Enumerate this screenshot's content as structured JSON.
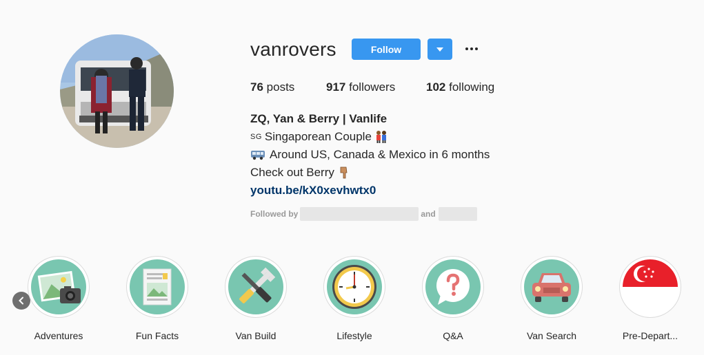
{
  "profile": {
    "username": "vanrovers",
    "follow_label": "Follow",
    "stats": {
      "posts_count": "76",
      "posts_label": "posts",
      "followers_count": "917",
      "followers_label": "followers",
      "following_count": "102",
      "following_label": "following"
    },
    "bio": {
      "name": "ZQ, Yan & Berry | Vanlife",
      "line1_flag": "SG",
      "line1": "Singaporean Couple",
      "line2": "Around US, Canada & Mexico in 6 months",
      "line3": "Check out Berry",
      "link": "youtu.be/kX0xevhwtx0"
    },
    "followed_by_label": "Followed by",
    "followed_by_and": "and"
  },
  "highlights": [
    {
      "label": "Adventures",
      "icon": "photo-camera-icon"
    },
    {
      "label": "Fun Facts",
      "icon": "document-icon"
    },
    {
      "label": "Van Build",
      "icon": "tools-icon"
    },
    {
      "label": "Lifestyle",
      "icon": "clock-icon"
    },
    {
      "label": "Q&A",
      "icon": "question-bubble-icon"
    },
    {
      "label": "Van Search",
      "icon": "car-icon"
    },
    {
      "label": "Pre-Depart...",
      "icon": "singapore-flag-icon"
    }
  ],
  "colors": {
    "accent": "#3897f0",
    "link": "#003569",
    "highlight_bg": "#79c6b0"
  }
}
